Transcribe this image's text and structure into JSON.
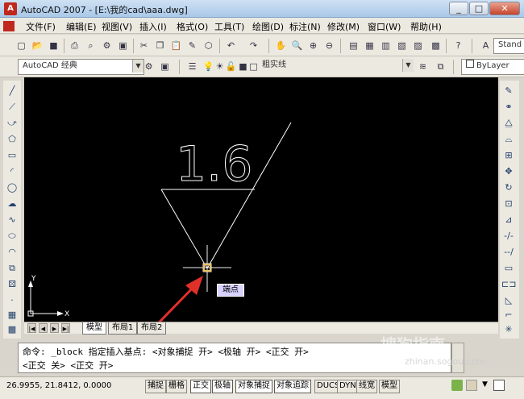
{
  "window": {
    "title": "AutoCAD 2007 - [E:\\我的cad\\aaa.dwg]",
    "controls": [
      "_",
      "□",
      "✕"
    ]
  },
  "menu": [
    "文件(F)",
    "编辑(E)",
    "视图(V)",
    "插入(I)",
    "格式(O)",
    "工具(T)",
    "绘图(D)",
    "标注(N)",
    "修改(M)",
    "窗口(W)",
    "帮助(H)"
  ],
  "toolbar": {
    "workspace": "AutoCAD 经典",
    "linetype": "粗实线",
    "color": "ByLayer",
    "text_style": "Stand"
  },
  "drawing": {
    "annotation_text": "1.6",
    "tooltip": "端点",
    "ucs_x": "X",
    "ucs_y": "Y"
  },
  "layout_tabs": [
    "模型",
    "布局1",
    "布局2"
  ],
  "command": {
    "line1": "命令: _block 指定插入基点: <对象捕捉 开> <极轴 开> <正交 开>",
    "line2": "<正交 关> <正交 开>",
    "prompt": "命令:"
  },
  "status": {
    "coords": "26.9955, 21.8412, 0.0000",
    "toggles": [
      {
        "label": "捕捉",
        "on": false
      },
      {
        "label": "栅格",
        "on": false
      },
      {
        "label": "正交",
        "on": true
      },
      {
        "label": "极轴",
        "on": true
      },
      {
        "label": "对象捕捉",
        "on": true
      },
      {
        "label": "对象追踪",
        "on": true
      },
      {
        "label": "DUCS",
        "on": false
      },
      {
        "label": "DYN",
        "on": false
      },
      {
        "label": "线宽",
        "on": false
      },
      {
        "label": "模型",
        "on": false
      }
    ]
  },
  "watermark": {
    "line1": "搜狗指南",
    "line2": "zhinan.sogou.com"
  },
  "colors": {
    "canvas_bg": "#000000",
    "drawing_line": "#ffffff",
    "arrow": "#e0302a",
    "cursor": "#f0f0f0",
    "snap_marker": "#f0c060"
  }
}
